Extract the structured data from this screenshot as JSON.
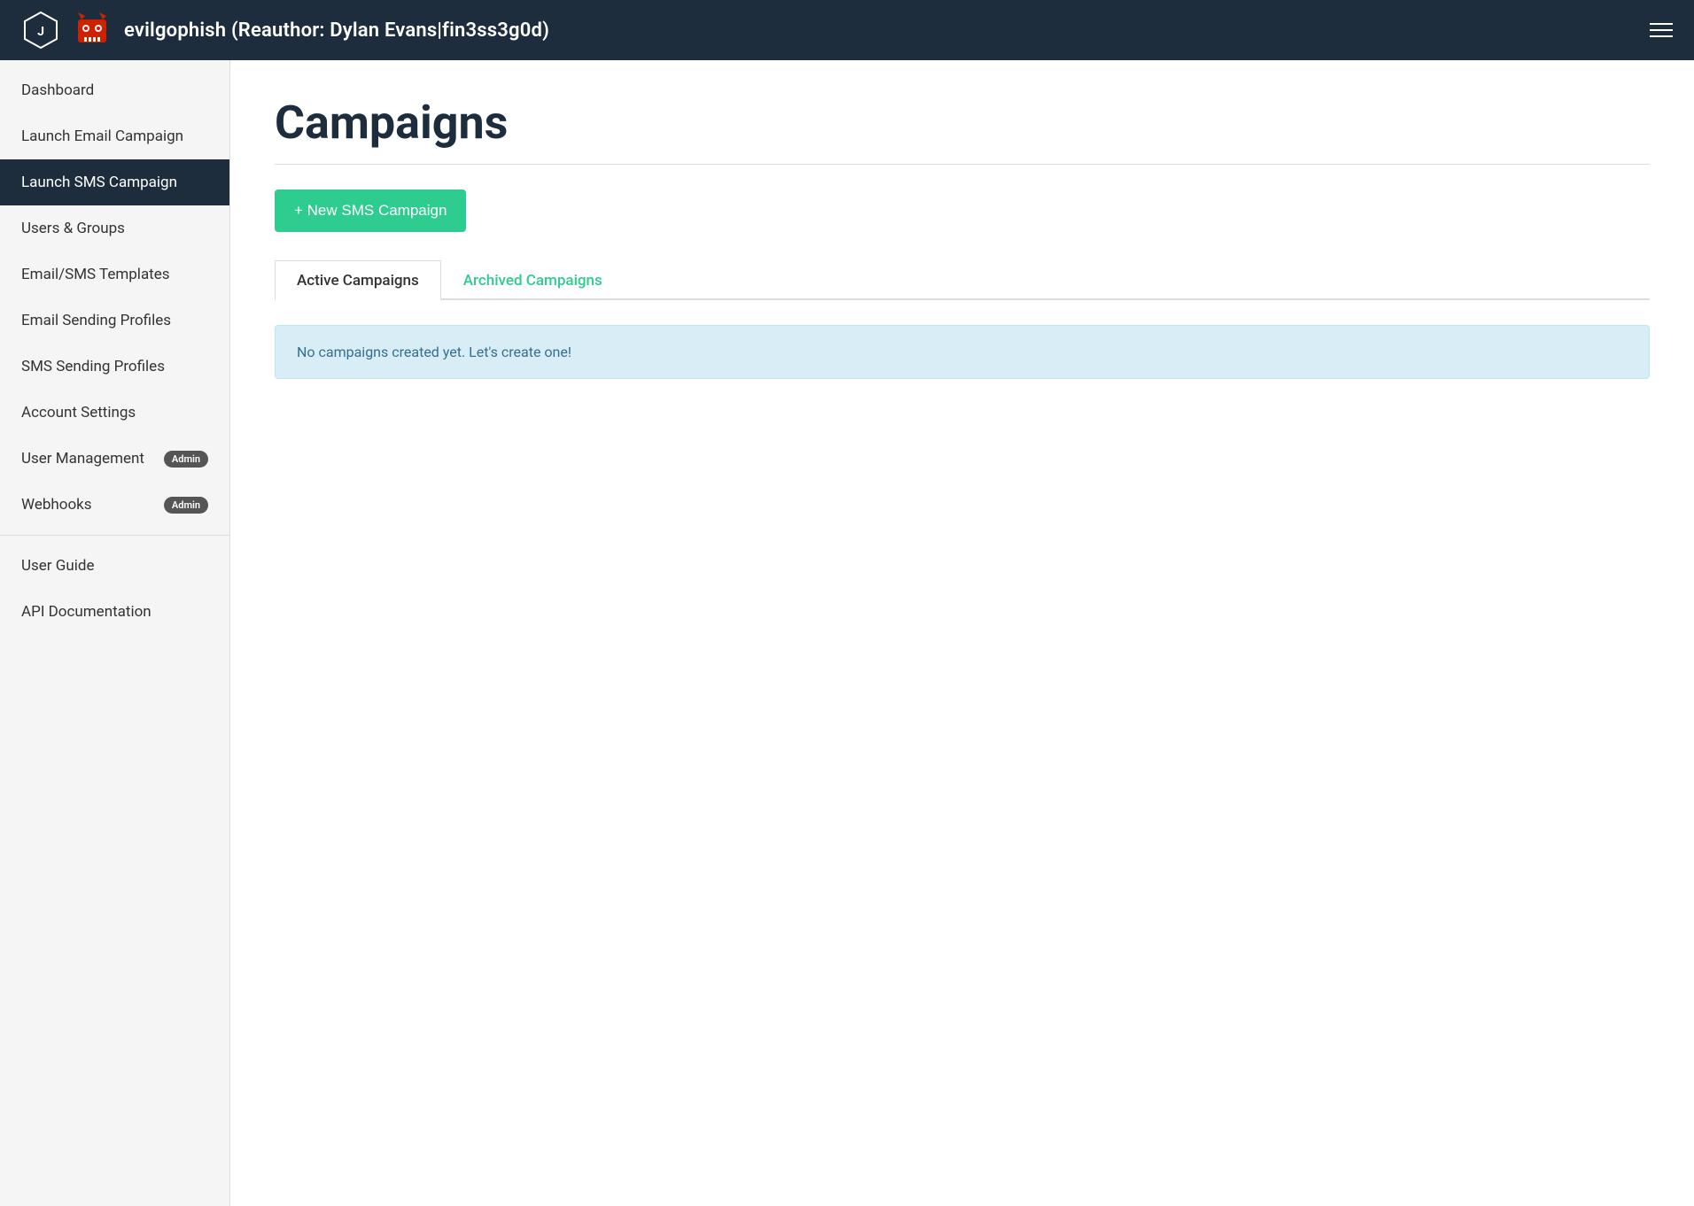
{
  "header": {
    "title": "evilgophish (Reauthor: Dylan Evans|fin3ss3g0d)",
    "menu_label": "Menu"
  },
  "sidebar": {
    "items": [
      {
        "id": "dashboard",
        "label": "Dashboard",
        "active": false,
        "badge": null
      },
      {
        "id": "launch-email-campaign",
        "label": "Launch Email Campaign",
        "active": false,
        "badge": null
      },
      {
        "id": "launch-sms-campaign",
        "label": "Launch SMS Campaign",
        "active": true,
        "badge": null
      },
      {
        "id": "users-groups",
        "label": "Users & Groups",
        "active": false,
        "badge": null
      },
      {
        "id": "email-sms-templates",
        "label": "Email/SMS Templates",
        "active": false,
        "badge": null
      },
      {
        "id": "email-sending-profiles",
        "label": "Email Sending Profiles",
        "active": false,
        "badge": null
      },
      {
        "id": "sms-sending-profiles",
        "label": "SMS Sending Profiles",
        "active": false,
        "badge": null
      },
      {
        "id": "account-settings",
        "label": "Account Settings",
        "active": false,
        "badge": null
      },
      {
        "id": "user-management",
        "label": "User Management",
        "active": false,
        "badge": "Admin"
      },
      {
        "id": "webhooks",
        "label": "Webhooks",
        "active": false,
        "badge": "Admin"
      }
    ],
    "bottom_items": [
      {
        "id": "user-guide",
        "label": "User Guide"
      },
      {
        "id": "api-documentation",
        "label": "API Documentation"
      }
    ]
  },
  "main": {
    "page_title": "Campaigns",
    "new_campaign_button": "+ New SMS Campaign",
    "tabs": [
      {
        "id": "active",
        "label": "Active Campaigns",
        "active": true
      },
      {
        "id": "archived",
        "label": "Archived Campaigns",
        "active": false
      }
    ],
    "empty_message": "No campaigns created yet. Let's create one!"
  }
}
